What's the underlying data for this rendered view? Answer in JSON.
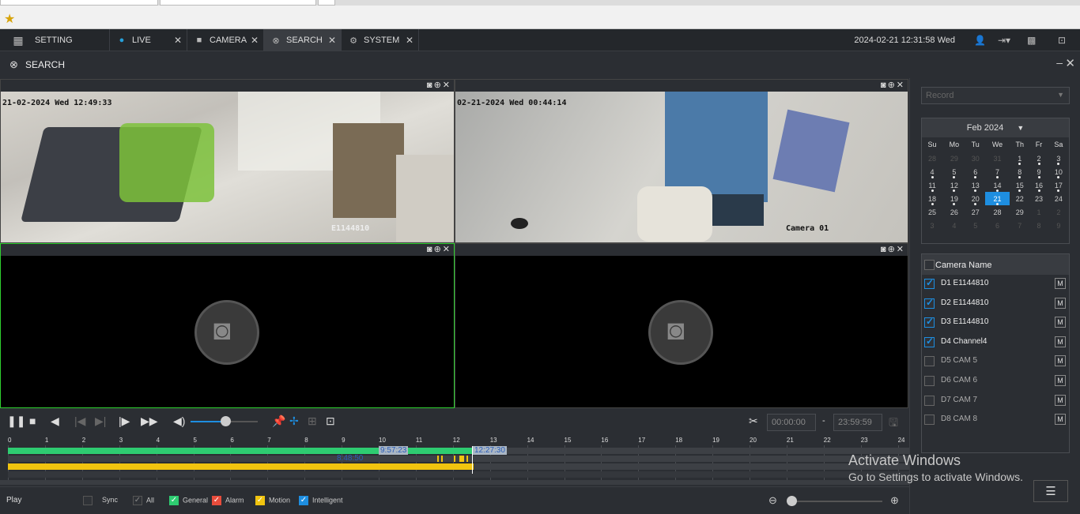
{
  "nav": {
    "setting": "SETTING",
    "live": "LIVE",
    "camera": "CAMERA",
    "search": "SEARCH",
    "system": "SYSTEM",
    "datetime": "2024-02-21 12:31:58 Wed"
  },
  "title": "SEARCH",
  "panes": {
    "p1_osd_top": "21-02-2024 Wed 12:49:33",
    "p1_osd_bottom": "E1144810",
    "p2_osd_top": "02-21-2024 Wed 00:44:14",
    "p2_osd_bottom": "Camera 01"
  },
  "record_type": "Record",
  "calendar": {
    "month_label": "Feb 2024",
    "weekdays": [
      "Su",
      "Mo",
      "Tu",
      "We",
      "Th",
      "Fr",
      "Sa"
    ],
    "weeks": [
      [
        "28",
        "29",
        "30",
        "31",
        "1",
        "2",
        "3"
      ],
      [
        "4",
        "5",
        "6",
        "7",
        "8",
        "9",
        "10"
      ],
      [
        "11",
        "12",
        "13",
        "14",
        "15",
        "16",
        "17"
      ],
      [
        "18",
        "19",
        "20",
        "21",
        "22",
        "23",
        "24"
      ],
      [
        "25",
        "26",
        "27",
        "28",
        "29",
        "1",
        "2"
      ],
      [
        "3",
        "4",
        "5",
        "6",
        "7",
        "8",
        "9"
      ]
    ],
    "today": "21"
  },
  "camlist": {
    "header": "Camera Name",
    "items": [
      {
        "name": "D1 E1144810",
        "checked": true
      },
      {
        "name": "D2 E1144810",
        "checked": true
      },
      {
        "name": "D3 E1144810",
        "checked": true
      },
      {
        "name": "D4 Channel4",
        "checked": true
      },
      {
        "name": "D5 CAM 5",
        "checked": false
      },
      {
        "name": "D6 CAM 6",
        "checked": false
      },
      {
        "name": "D7 CAM 7",
        "checked": false
      },
      {
        "name": "D8 CAM 8",
        "checked": false
      }
    ],
    "m_label": "M"
  },
  "clip": {
    "start": "00:00:00",
    "sep": "-",
    "end": "23:59:59"
  },
  "timeline": {
    "ticks": [
      "0",
      "1",
      "2",
      "3",
      "4",
      "5",
      "6",
      "7",
      "8",
      "9",
      "10",
      "11",
      "12",
      "13",
      "14",
      "15",
      "16",
      "17",
      "18",
      "19",
      "20",
      "21",
      "22",
      "23",
      "24"
    ],
    "label_a": "9:57:23",
    "label_b": "12:27:30",
    "label_c": "8:48:50"
  },
  "bottom": {
    "play": "Play",
    "sync": "Sync",
    "all": "All",
    "general": "General",
    "alarm": "Alarm",
    "motion": "Motion",
    "intelligent": "Intelligent"
  },
  "watermark": {
    "line1": "Activate Windows",
    "line2": "Go to Settings to activate Windows."
  },
  "colors": {
    "general": "#2ecc71",
    "alarm": "#e74c3c",
    "motion": "#f1c40f",
    "intelligent": "#1e8ee0",
    "selected_pane": "#2fd12f"
  }
}
